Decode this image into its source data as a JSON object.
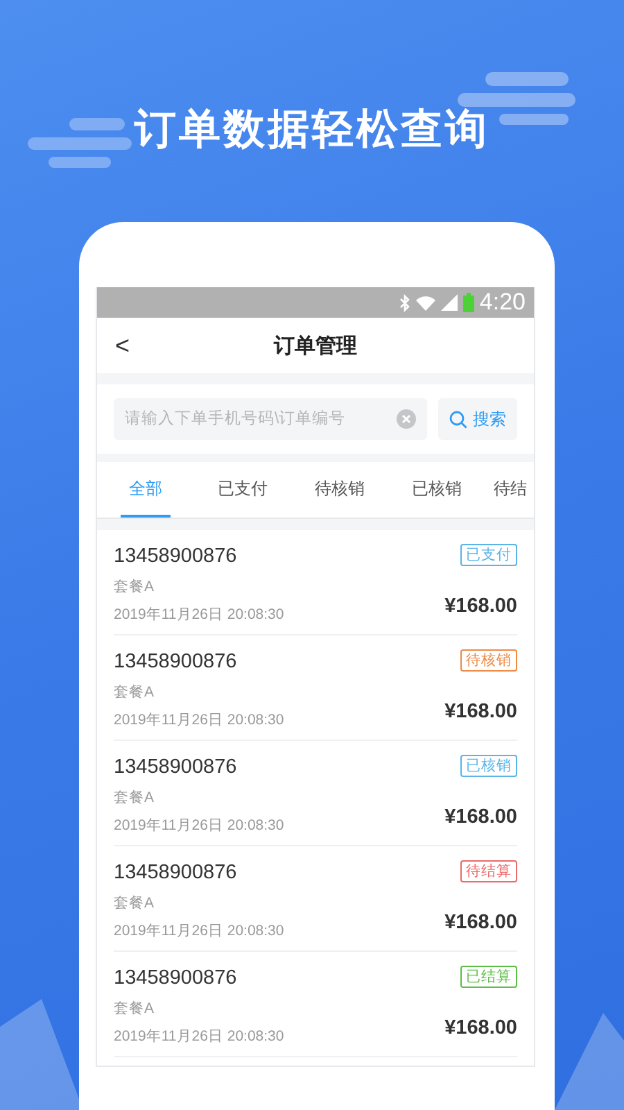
{
  "headline": "订单数据轻松查询",
  "status_bar": {
    "time": "4:20"
  },
  "nav": {
    "back": "<",
    "title": "订单管理"
  },
  "search": {
    "placeholder": "请输入下单手机号码\\订单编号",
    "button": "搜索"
  },
  "tabs": [
    {
      "label": "全部",
      "selected": true
    },
    {
      "label": "已支付",
      "selected": false
    },
    {
      "label": "待核销",
      "selected": false
    },
    {
      "label": "已核销",
      "selected": false
    },
    {
      "label": "待结",
      "selected": false
    }
  ],
  "orders": [
    {
      "phone": "13458900876",
      "status": "已支付",
      "color": "#5ab4e8",
      "package": "套餐A",
      "time": "2019年11月26日 20:08:30",
      "price": "¥168.00"
    },
    {
      "phone": "13458900876",
      "status": "待核销",
      "color": "#ef8a45",
      "package": "套餐A",
      "time": "2019年11月26日 20:08:30",
      "price": "¥168.00"
    },
    {
      "phone": "13458900876",
      "status": "已核销",
      "color": "#5ab4e8",
      "package": "套餐A",
      "time": "2019年11月26日 20:08:30",
      "price": "¥168.00"
    },
    {
      "phone": "13458900876",
      "status": "待结算",
      "color": "#ec6a6a",
      "package": "套餐A",
      "time": "2019年11月26日 20:08:30",
      "price": "¥168.00"
    },
    {
      "phone": "13458900876",
      "status": "已结算",
      "color": "#5cbf45",
      "package": "套餐A",
      "time": "2019年11月26日 20:08:30",
      "price": "¥168.00"
    }
  ]
}
